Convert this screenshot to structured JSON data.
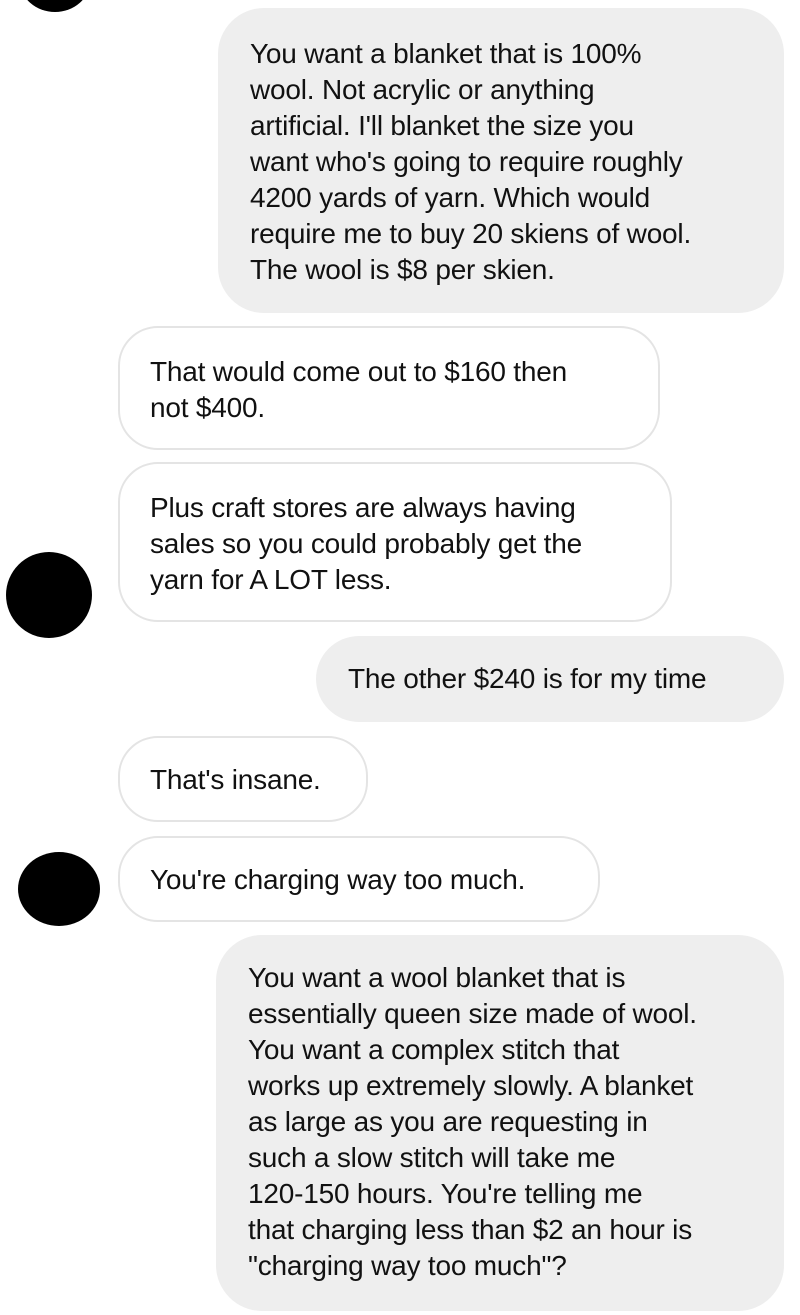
{
  "conversation": {
    "messages": [
      {
        "sender": "me",
        "lines": [
          "You want a blanket that is 100%",
          "wool. Not acrylic or anything",
          "artificial. I'll blanket the size you",
          "want who's going to require roughly",
          "4200 yards of yarn. Which would",
          "require me to buy 20 skiens of wool.",
          "The wool is $8 per skien."
        ]
      },
      {
        "sender": "them",
        "lines": [
          "That would come out to $160 then",
          "not $400."
        ]
      },
      {
        "sender": "them",
        "lines": [
          "Plus craft stores are always having",
          "sales so you could probably get the",
          "yarn for A LOT less."
        ]
      },
      {
        "sender": "me",
        "lines": [
          "The other $240 is for my time"
        ]
      },
      {
        "sender": "them",
        "lines": [
          "That's insane."
        ]
      },
      {
        "sender": "them",
        "lines": [
          "You're charging way too much."
        ]
      },
      {
        "sender": "me",
        "lines": [
          "You want a wool blanket that is",
          "essentially queen size made of wool.",
          "You want a complex stitch that",
          "works up extremely slowly. A blanket",
          "as large as you are requesting in",
          "such a slow stitch will take me",
          "120-150 hours. You're telling me",
          "that charging less than $2 an hour is",
          "\"charging way too much\"?"
        ]
      }
    ]
  },
  "colors": {
    "outgoing_bubble": "#eeeeee",
    "incoming_bubble": "#ffffff",
    "incoming_border": "#e4e4e4",
    "avatar_redaction": "#000000",
    "text": "#111111"
  }
}
